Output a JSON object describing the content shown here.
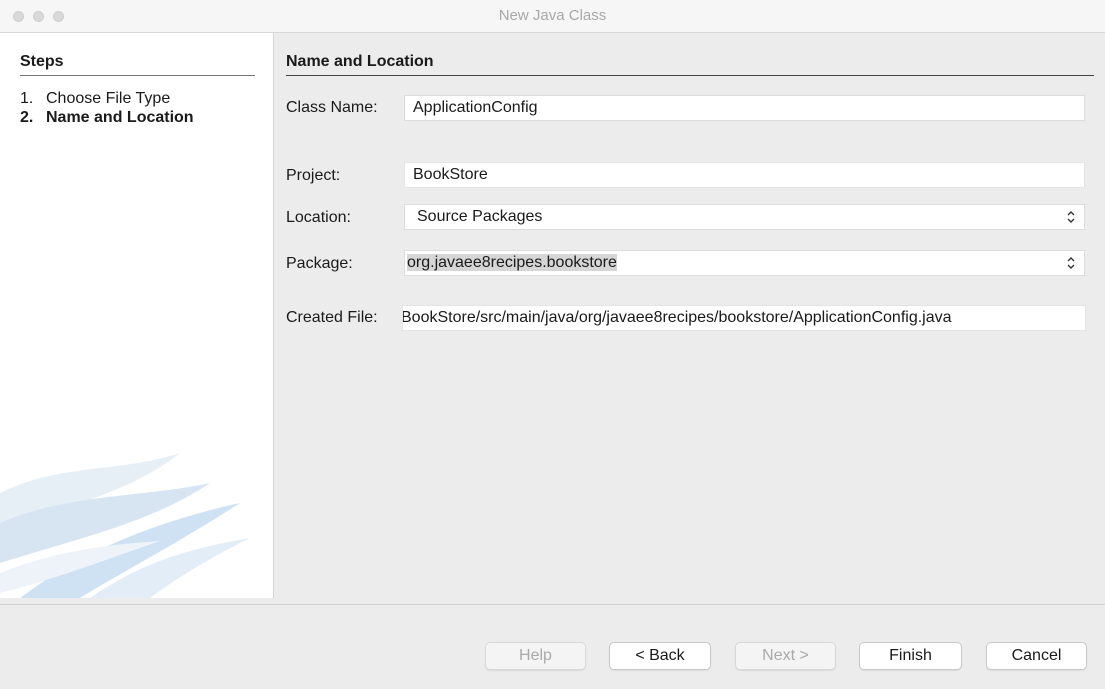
{
  "window": {
    "title": "New Java Class"
  },
  "steps": {
    "heading": "Steps",
    "items": [
      {
        "num": "1.",
        "label": "Choose File Type"
      },
      {
        "num": "2.",
        "label": "Name and Location"
      }
    ]
  },
  "form": {
    "heading": "Name and Location",
    "class_name": {
      "label": "Class Name:",
      "value": "ApplicationConfig"
    },
    "project": {
      "label": "Project:",
      "value": "BookStore"
    },
    "location": {
      "label": "Location:",
      "value": "Source Packages"
    },
    "package": {
      "label": "Package:",
      "value": "org.javaee8recipes.bookstore"
    },
    "created_file": {
      "label": "Created File:",
      "value": "BookStore/src/main/java/org/javaee8recipes/bookstore/ApplicationConfig.java"
    }
  },
  "buttons": {
    "help": "Help",
    "back": "< Back",
    "next": "Next >",
    "finish": "Finish",
    "cancel": "Cancel"
  },
  "icons": {
    "combo_arrow": "updown-chevron-icon",
    "traffic_lights": "window-control-icon"
  },
  "colors": {
    "panel_bg": "#ececec",
    "steps_bg": "#ffffff",
    "disabled_text": "#a9a9a9"
  }
}
